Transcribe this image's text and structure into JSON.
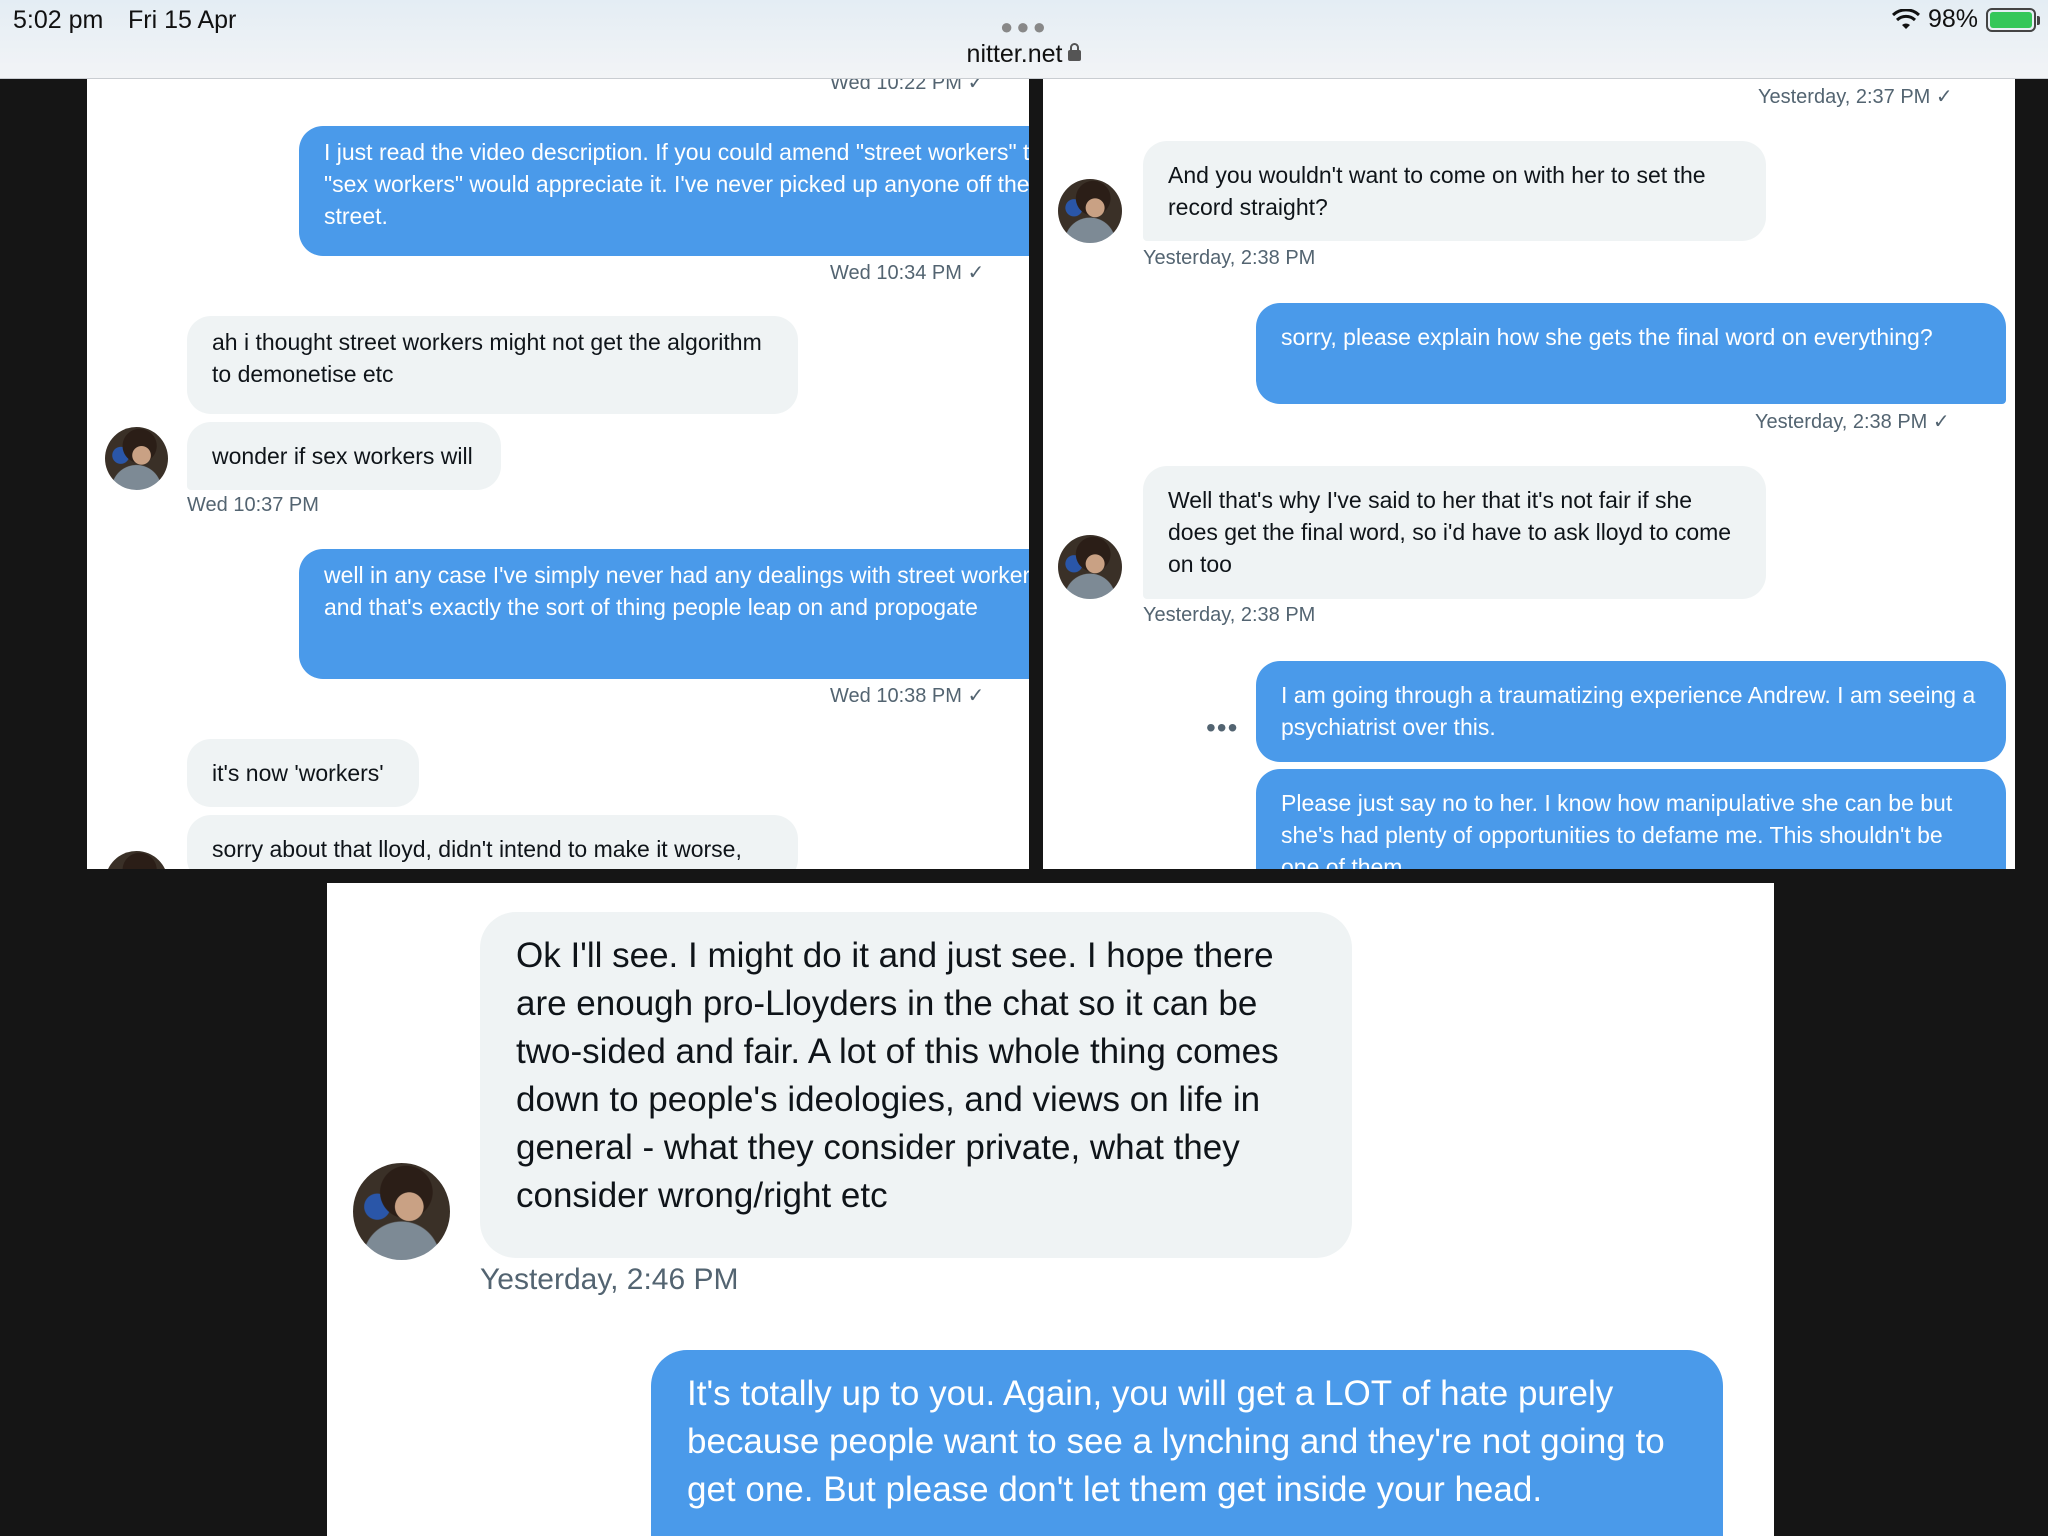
{
  "status_bar": {
    "time": "5:02 pm",
    "date": "Fri 15 Apr",
    "url": "nitter.net",
    "battery": "98%",
    "icons": [
      "wifi-icon",
      "battery-icon",
      "lock-icon"
    ]
  },
  "panel_top_left": {
    "messages": [
      {
        "ts": "Wed 10:22 PM ✓"
      },
      {
        "text": "I just read the video description. If you could amend \"street workers\" to \"sex workers\" would appreciate it. I've never picked up anyone off the street.",
        "ts": "Wed 10:34 PM ✓"
      },
      {
        "text": "ah i thought street workers might not get the algorithm to demonetise etc"
      },
      {
        "text": "wonder if sex workers will",
        "ts": "Wed 10:37 PM"
      },
      {
        "text": "well in any case I've simply never had any dealings with street workers and that's exactly the sort of thing people leap on and propogate",
        "ts": "Wed 10:38 PM ✓"
      },
      {
        "text": "it's now 'workers'"
      },
      {
        "text": "sorry about that lloyd, didn't intend to make it worse,"
      }
    ]
  },
  "panel_top_right": {
    "messages": [
      {
        "ts": "Yesterday, 2:37 PM ✓"
      },
      {
        "text": "And you wouldn't want to come on with her to set the record straight?",
        "ts": "Yesterday, 2:38 PM"
      },
      {
        "text": "sorry, please explain how she gets the final word on everything?",
        "ts": "Yesterday, 2:38 PM ✓"
      },
      {
        "text": "Well that's why I've said to her that it's not fair if she does get the final word, so i'd have to ask lloyd to come on too",
        "ts": "Yesterday, 2:38 PM"
      },
      {
        "text": "I am going through a traumatizing experience Andrew. I am seeing a psychiatrist over this."
      },
      {
        "text": "Please just say no to her. I know how manipulative she can be but she's had plenty of opportunities to defame me. This shouldn't be one of them."
      }
    ],
    "more_label": "•••"
  },
  "panel_bottom": {
    "messages": [
      {
        "text": "Ok I'll see. I might do it and just see. I hope there are enough pro-Lloyders in the chat so it can be two-sided and fair. A lot of this whole thing comes down to people's ideologies, and views on life in general - what they consider private, what they consider wrong/right etc",
        "ts": "Yesterday, 2:46 PM"
      },
      {
        "text": "It's totally up to you. Again, you will get a LOT of hate purely because people want to see a lynching and they're not going to get one. But please don't let them get inside your head."
      }
    ]
  },
  "colors": {
    "outgoing_bubble": "#4a9aea",
    "incoming_bubble": "#eff3f4",
    "timestamp": "#536471",
    "backdrop": "#151515"
  }
}
